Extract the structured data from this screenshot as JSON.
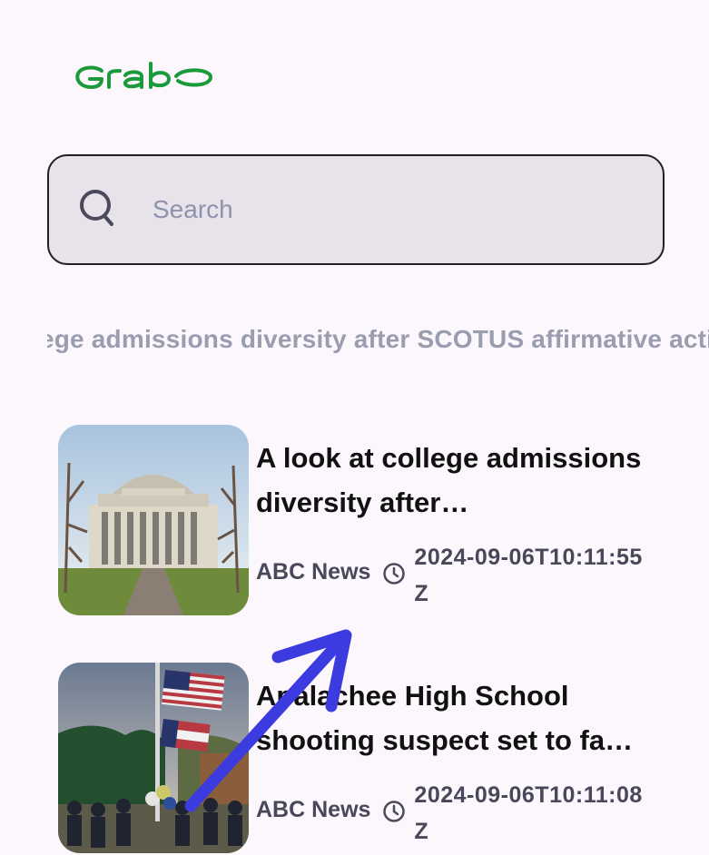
{
  "brand": {
    "logo_text": "Grab",
    "color": "#1a9a3b"
  },
  "search": {
    "placeholder": "Search",
    "value": "",
    "icon": "search-icon"
  },
  "ticker": {
    "text": "llege admissions diversity after SCOTUS affirmative action ruling"
  },
  "news": [
    {
      "title": "A look at college admissions diversity after…",
      "source": "ABC News",
      "timestamp": "2024-09-06T10:11:55Z",
      "icon": "clock-icon"
    },
    {
      "title": "Apalachee High School shooting suspect set to fa…",
      "source": "ABC News",
      "timestamp": "2024-09-06T10:11:08Z",
      "icon": "clock-icon"
    }
  ],
  "colors": {
    "background": "#fcf7fc",
    "search_bg": "#e8e3ea",
    "ticker_text": "#9a9db0",
    "meta_text": "#48485a",
    "swipe_arrow": "#3b3be0"
  }
}
